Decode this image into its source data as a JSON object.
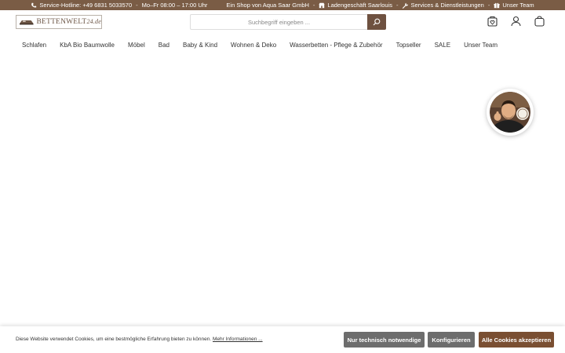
{
  "topbar": {
    "hotline": "Service-Hotline: +49 6831 5033570",
    "hours": "Mo–Fr 08:00 – 17:00 Uhr",
    "shop": "Ein Shop von Aqua Saar GmbH",
    "store": "Ladengeschäft Saarlouis",
    "services": "Services & Dienstleistungen",
    "team": "Unser Team",
    "separator": "-"
  },
  "header": {
    "logo_main": "BETTENWELT",
    "logo_domain": "24.de",
    "search_placeholder": "Suchbegriff eingeben ..."
  },
  "nav": {
    "items": [
      {
        "label": "Schlafen"
      },
      {
        "label": "KbA Bio Baumwolle"
      },
      {
        "label": "Möbel"
      },
      {
        "label": "Bad"
      },
      {
        "label": "Baby & Kind"
      },
      {
        "label": "Wohnen & Deko"
      },
      {
        "label": "Wasserbetten - Pflege & Zubehör"
      },
      {
        "label": "Topseller"
      },
      {
        "label": "SALE"
      },
      {
        "label": "Unser Team"
      }
    ]
  },
  "cookie": {
    "text": "Diese Website verwendet Cookies, um eine bestmögliche Erfahrung bieten zu können.",
    "more_link": "Mehr Informationen ...",
    "btn_necessary": "Nur technisch notwendige",
    "btn_configure": "Konfigurieren",
    "btn_accept_all": "Alle Cookies akzeptieren"
  },
  "colors": {
    "topbar_bg": "#7a5c45",
    "search_button": "#6e5140",
    "accept_button": "#7a4f32",
    "secondary_button": "#6d6d6d"
  },
  "icons": {
    "hotline": "phone-icon",
    "store": "store-icon",
    "services": "wrench-icon",
    "team": "team-icon",
    "search": "search-icon",
    "wishlist": "wishlist-icon",
    "account": "user-icon",
    "cart": "bag-icon"
  }
}
